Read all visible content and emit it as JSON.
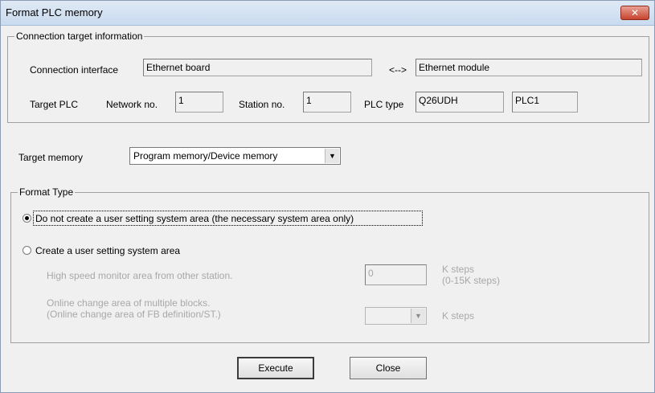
{
  "window": {
    "title": "Format PLC memory",
    "close_glyph": "✕"
  },
  "connection": {
    "legend": "Connection target information",
    "interface_label": "Connection interface",
    "interface_value": "Ethernet board",
    "arrow": "<-->",
    "module_value": "Ethernet module",
    "target_plc_label": "Target PLC",
    "network_label": "Network no.",
    "network_value": "1",
    "station_label": "Station no.",
    "station_value": "1",
    "plc_type_label": "PLC type",
    "plc_type_value": "Q26UDH",
    "plc_name_value": "PLC1"
  },
  "target_memory": {
    "label": "Target memory",
    "value": "Program memory/Device memory"
  },
  "format_type": {
    "legend": "Format Type",
    "option1": "Do not create a user setting system area (the necessary system area only)",
    "option1_selected": true,
    "option2": "Create a user setting system area",
    "option2_selected": false,
    "high_speed_label": "High speed monitor area from other station.",
    "high_speed_value": "0",
    "high_speed_unit": "K steps",
    "high_speed_range": "(0-15K steps)",
    "online_change_line1": "Online change area of multiple blocks.",
    "online_change_line2": "(Online change area of FB definition/ST.)",
    "online_change_value": "",
    "online_change_unit": "K steps"
  },
  "buttons": {
    "execute": "Execute",
    "close": "Close"
  }
}
